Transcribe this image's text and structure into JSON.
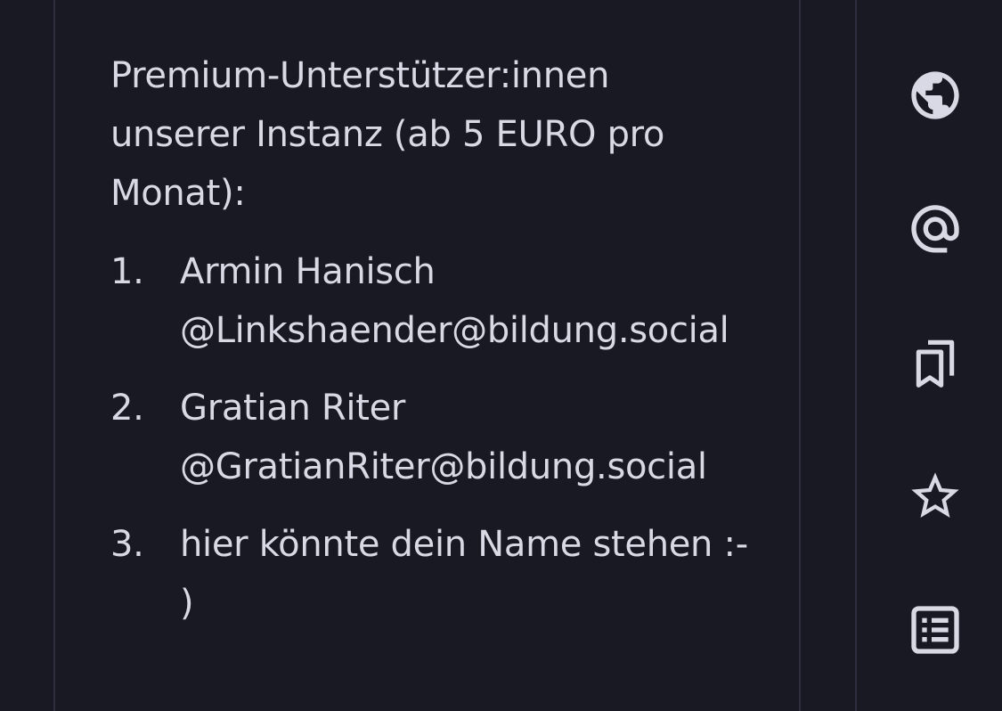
{
  "post": {
    "intro": "Premium-Unterstützer:innen unserer Instanz (ab 5 EURO pro Monat):",
    "list": [
      {
        "number": "1.",
        "name": "Armin Hanisch",
        "handle": "@Linkshaender@bildung.social"
      },
      {
        "number": "2.",
        "name": "Gratian Riter",
        "handle": "@GratianRiter@bildung.social"
      },
      {
        "number": "3.",
        "name": "hier könnte dein Name stehen :-",
        "handle": ")"
      }
    ]
  },
  "rail": {
    "icons": [
      "globe-icon",
      "at-mention-icon",
      "bookmarks-icon",
      "star-icon",
      "list-icon"
    ]
  },
  "colors": {
    "background": "#191923",
    "text": "#d9d9e5",
    "divider": "#2e2e3e"
  }
}
